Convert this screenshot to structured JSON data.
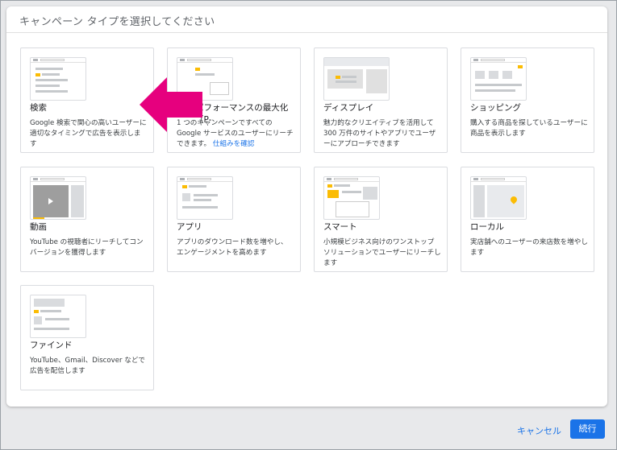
{
  "dialog": {
    "title": "キャンペーン タイプを選択してください"
  },
  "cards": [
    {
      "label": "検索",
      "desc": "Google 検索で関心の高いユーザーに適切なタイミングで広告を表示します"
    },
    {
      "label": "パフォーマンスの最大化（P-",
      "desc": "1 つのキャンペーンですべての Google サービスのユーザーにリーチできます。",
      "link": "仕組みを確認"
    },
    {
      "label": "ディスプレイ",
      "desc": "魅力的なクリエイティブを活用して 300 万件のサイトやアプリでユーザーにアプローチできます"
    },
    {
      "label": "ショッピング",
      "desc": "購入する商品を探しているユーザーに商品を表示します"
    },
    {
      "label": "動画",
      "desc": "YouTube の視聴者にリーチしてコンバージョンを獲得します"
    },
    {
      "label": "アプリ",
      "desc": "アプリのダウンロード数を増やし、エンゲージメントを高めます"
    },
    {
      "label": "スマート",
      "desc": "小規模ビジネス向けのワンストップ ソリューションでユーザーにリーチします"
    },
    {
      "label": "ローカル",
      "desc": "実店舗へのユーザーの来店数を増やします"
    },
    {
      "label": "ファインド",
      "desc": "YouTube、Gmail、Discover などで広告を配信します"
    }
  ],
  "footer": {
    "cancel_label": "キャンセル",
    "next_label": "続行"
  },
  "colors": {
    "accent": "#1a73e8",
    "arrow": "#e6007e",
    "thumb_highlight": "#fbbc04"
  }
}
